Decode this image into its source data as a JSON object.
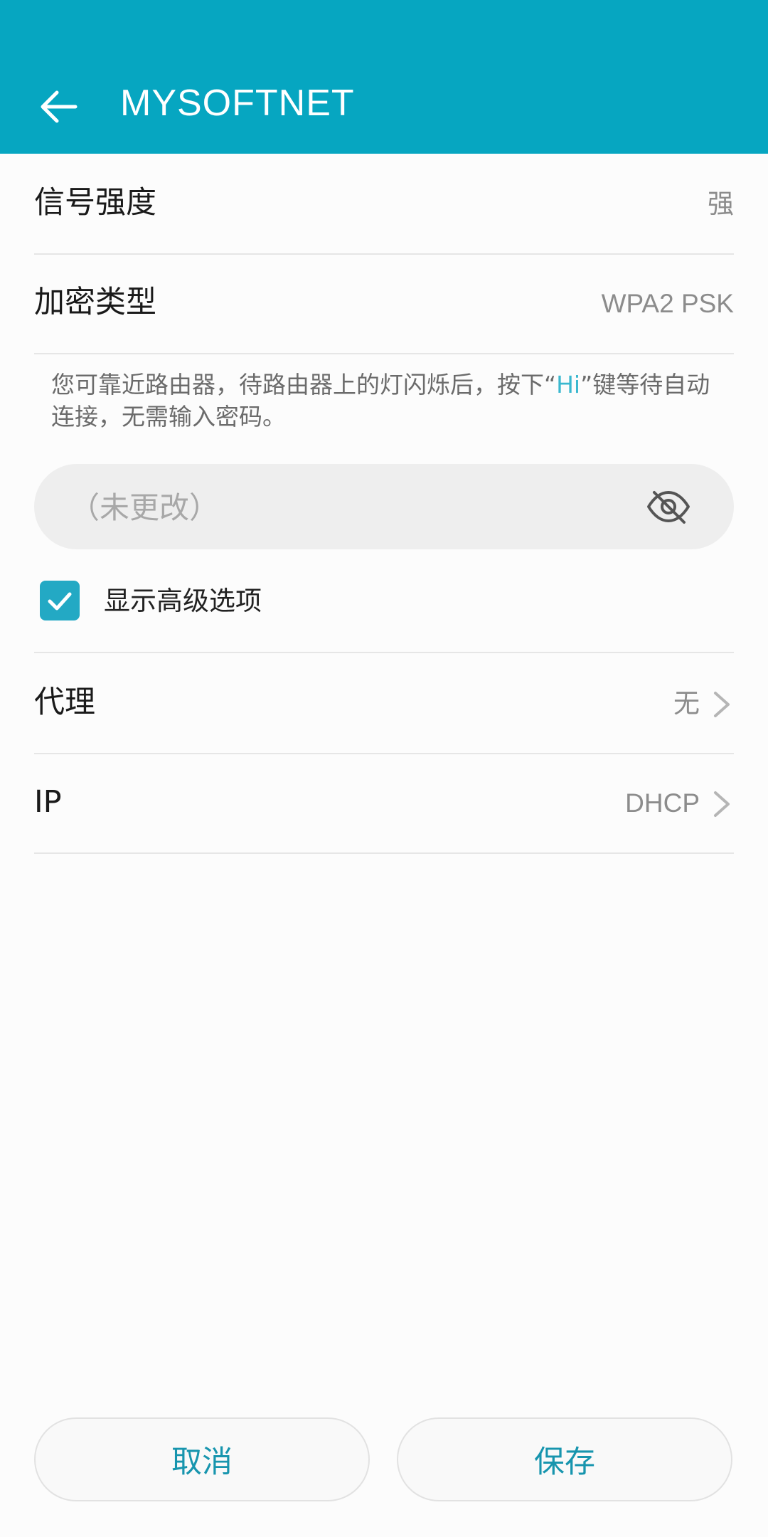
{
  "header": {
    "title": "MYSOFTNET",
    "back_icon": "arrow-left-icon",
    "background": "#06a6c1"
  },
  "signal": {
    "label": "信号强度",
    "value": "强"
  },
  "encryption": {
    "label": "加密类型",
    "value": "WPA2 PSK"
  },
  "hint": {
    "before": "您可靠近路由器，待路由器上的灯闪烁后，按下“",
    "highlight": "Hi",
    "after": "”键等待自动连接，无需输入密码。",
    "highlight_color": "#3ab8cf"
  },
  "password": {
    "placeholder": "（未更改）",
    "value": "",
    "toggle_icon": "eye-off-icon"
  },
  "advanced": {
    "label": "显示高级选项",
    "checked": true,
    "accent": "#23a9c4"
  },
  "proxy": {
    "label": "代理",
    "value": "无"
  },
  "ip": {
    "label": "IP",
    "value": "DHCP"
  },
  "buttons": {
    "cancel": "取消",
    "save": "保存",
    "text_color": "#1795ae"
  }
}
